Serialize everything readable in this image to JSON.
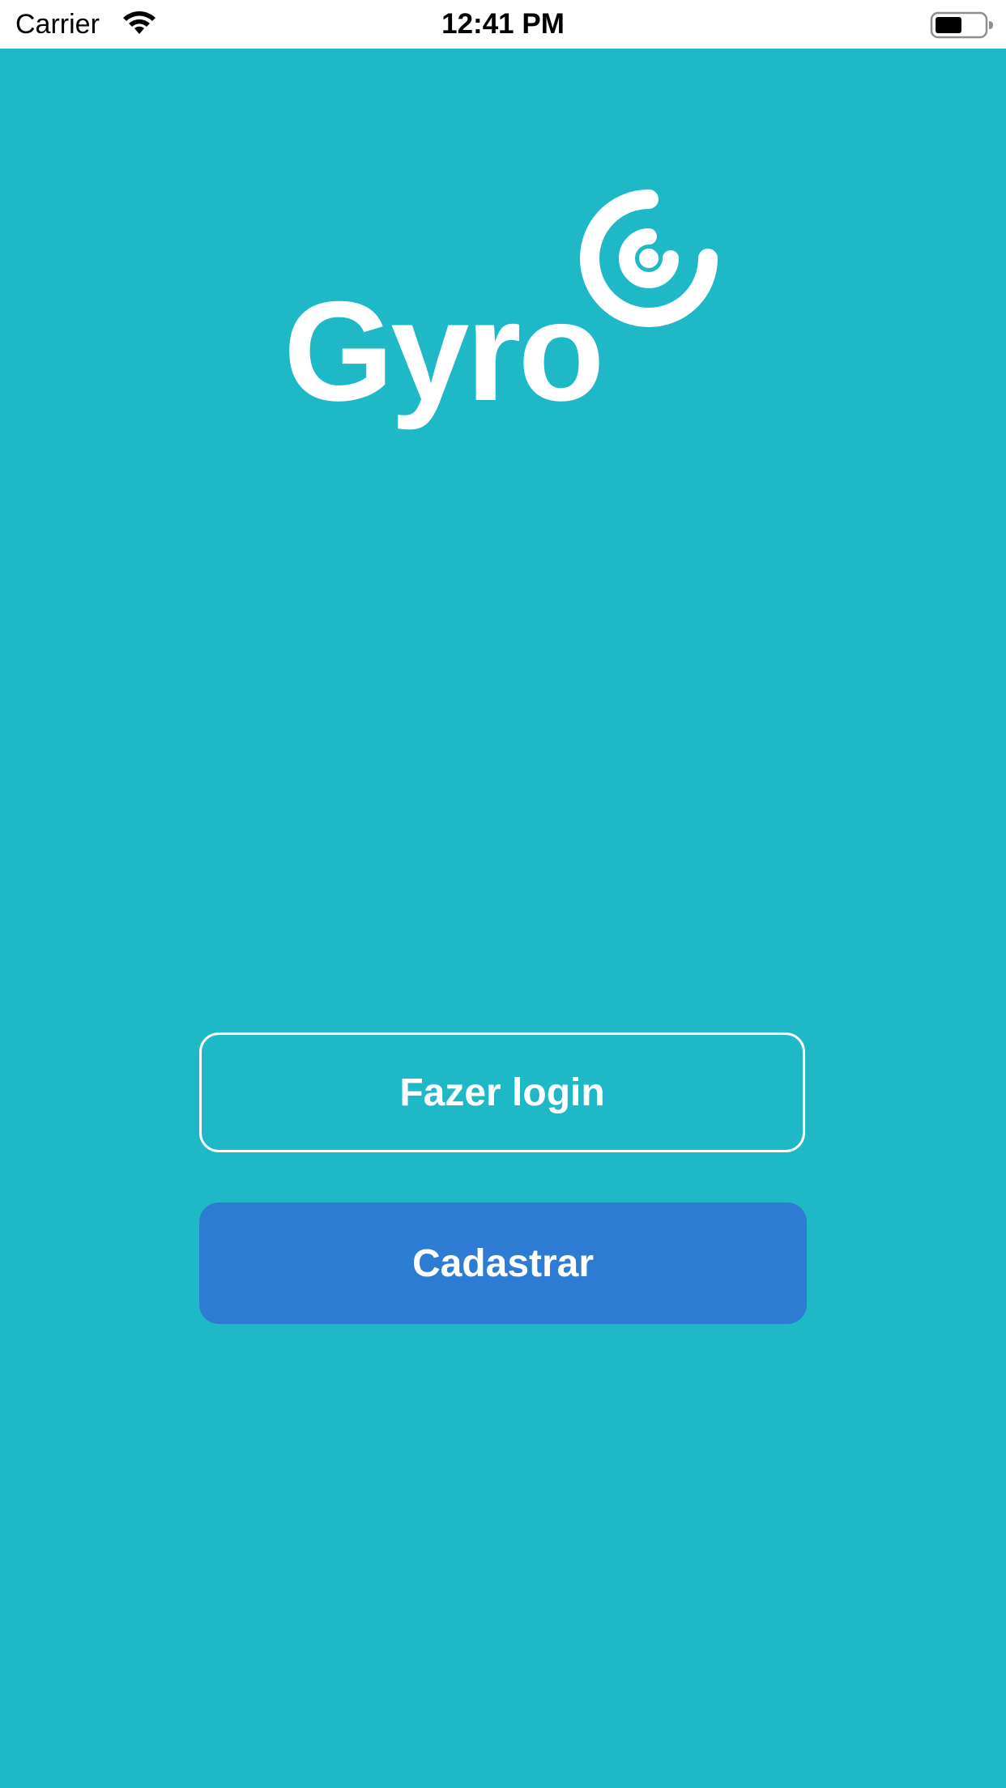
{
  "status_bar": {
    "carrier": "Carrier",
    "time": "12:41 PM",
    "wifi_icon": "wifi-icon",
    "battery_icon": "battery-icon"
  },
  "brand": {
    "logo_text": "Gyro",
    "logo_icon": "gyro-spiral-icon",
    "background_color": "#1fb8c6",
    "primary_color": "#2d7bd2",
    "text_color": "#ffffff"
  },
  "actions": {
    "login_label": "Fazer login",
    "signup_label": "Cadastrar"
  }
}
